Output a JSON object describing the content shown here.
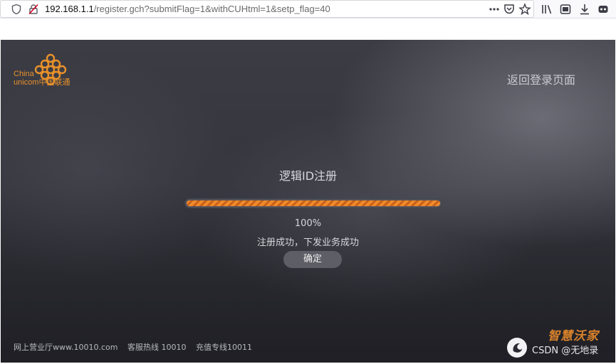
{
  "browser": {
    "url_host": "192.168.1.1",
    "url_path": "/register.gch?submitFlag=1&withCUHtml=1&setp_flag=40"
  },
  "icons": {
    "shield": "shield-icon",
    "insecure": "insecure-lock-icon",
    "more": "more-actions-icon",
    "pocket": "pocket-icon",
    "bookmark": "bookmark-star-icon",
    "library": "library-icon",
    "reader": "reader-view-icon",
    "download": "download-icon",
    "extension": "extension-icon"
  },
  "logo": {
    "line1": "China",
    "line2": "unicom中国联通",
    "color": "#e8912a"
  },
  "header": {
    "back_label": "返回登录页面"
  },
  "registration": {
    "title": "逻辑ID注册",
    "progress_percent": 100,
    "percent_label": "100%",
    "status_message": "注册成功，下发业务成功",
    "ok_label": "确定"
  },
  "footer": {
    "website": "网上营业厅www.10010.com",
    "hotline": "客服热线 10010",
    "recharge": "充值专线10011"
  },
  "brand": {
    "label": "智慧沃家"
  },
  "watermark": {
    "text": "CSDN @无地录"
  },
  "colors": {
    "accent": "#f08a2a"
  }
}
